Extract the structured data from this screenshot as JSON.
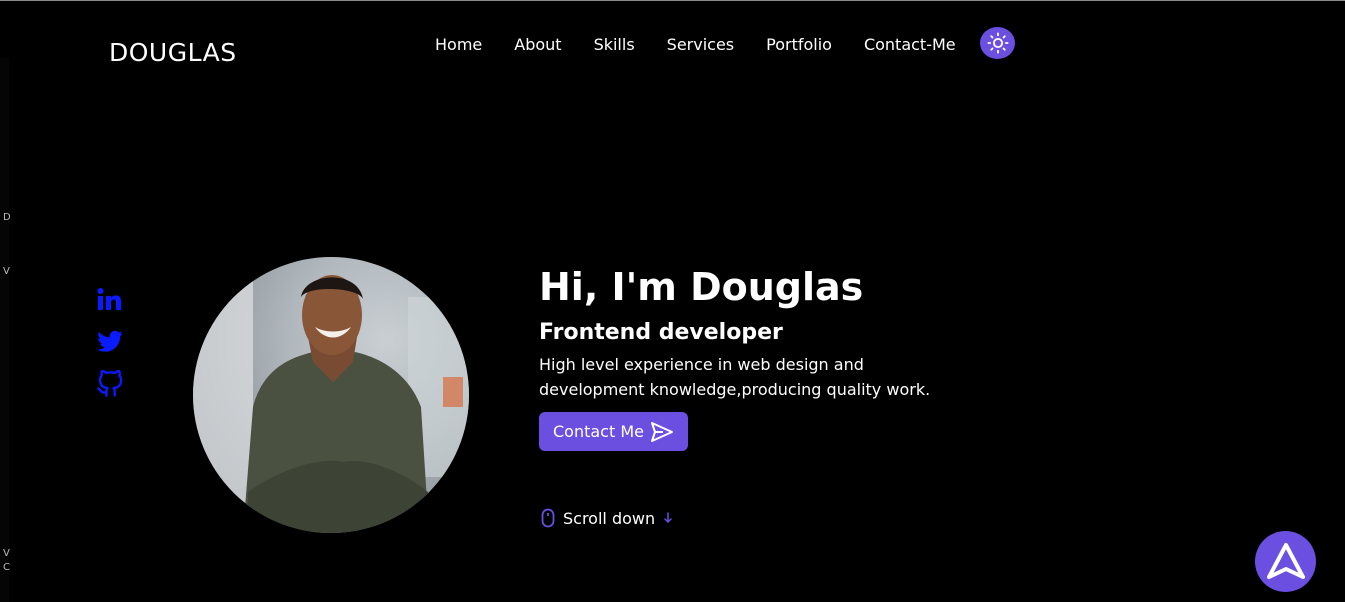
{
  "header": {
    "logo": "DOUGLAS"
  },
  "nav": [
    {
      "label": "Home"
    },
    {
      "label": "About"
    },
    {
      "label": "Skills"
    },
    {
      "label": "Services"
    },
    {
      "label": "Portfolio"
    },
    {
      "label": "Contact-Me"
    }
  ],
  "theme_toggle": {
    "icon": "sun-icon"
  },
  "socials": [
    {
      "icon": "linkedin-icon"
    },
    {
      "icon": "twitter-icon"
    },
    {
      "icon": "github-icon"
    }
  ],
  "hero": {
    "title": "Hi, I'm Douglas",
    "subtitle": "Frontend developer",
    "description": "High level experience in web design and development knowledge,producing quality work.",
    "button_label": "Contact Me",
    "scroll_label": "Scroll down"
  },
  "left_edge_chars": [
    "D",
    "V",
    "V",
    "C"
  ],
  "colors": {
    "accent": "#6a4fe0",
    "social_blue": "#0a1cff",
    "background": "#000000"
  }
}
